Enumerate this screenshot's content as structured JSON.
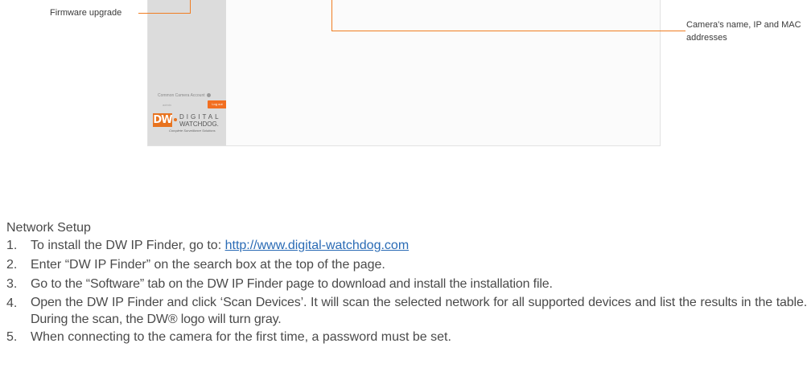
{
  "callouts": {
    "firmware": "Firmware upgrade",
    "camera_info": "Camera's name, IP and MAC addresses"
  },
  "screenshot": {
    "common_account_label": "Common Camera Account",
    "user_field": "admin",
    "logout_label": "Log out",
    "logo": {
      "letters": "DW",
      "line1": "DIGITAL",
      "line2": "WATCHDOG.",
      "tagline": "Complete Surveillance Solutions"
    }
  },
  "section_title": "Network Setup",
  "steps": [
    {
      "num": "1.",
      "prefix": "To install the DW IP Finder, go to: ",
      "link": "http://www.digital-watchdog.com"
    },
    {
      "num": "2.",
      "text": "Enter “DW IP Finder” on the search box at the top of the page."
    },
    {
      "num": "3.",
      "text": "Go to the “Software” tab on the DW IP Finder page to download and install the installation file."
    },
    {
      "num": "4.",
      "text": "Open the DW IP Finder and click ‘Scan Devices’. It will scan the selected network for all supported devices and list the results in the table. During the scan, the DW® logo will turn gray."
    },
    {
      "num": "5.",
      "text": "When connecting to the camera for the first time, a password must be set."
    }
  ],
  "colors": {
    "accent": "#f07d22",
    "logo_orange": "#e8731f",
    "link": "#2a6bb5"
  }
}
